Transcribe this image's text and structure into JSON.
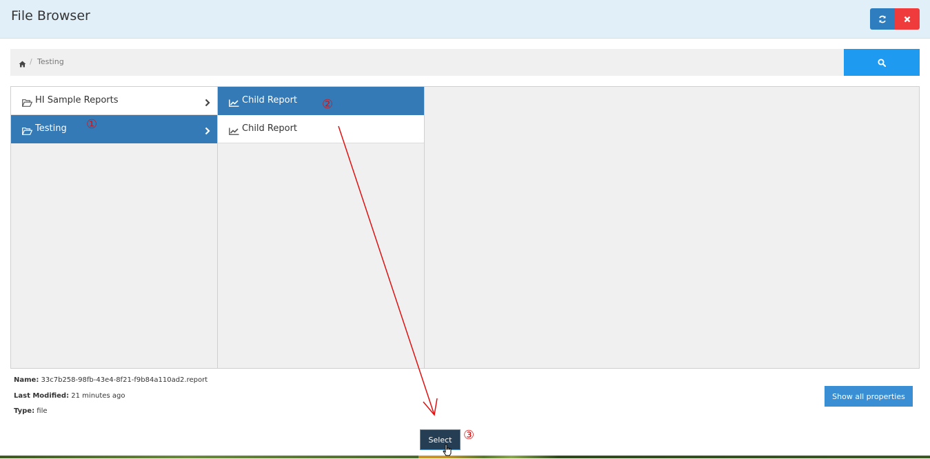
{
  "header": {
    "title": "File Browser",
    "refresh_icon": "refresh-icon",
    "close_icon": "close-icon"
  },
  "breadcrumb": {
    "home_icon": "home-icon",
    "separator": "/",
    "items": [
      "Testing"
    ]
  },
  "search": {
    "icon": "search-icon"
  },
  "columns": [
    {
      "items": [
        {
          "label": "HI Sample Reports",
          "icon": "folder-open-icon",
          "selected": false,
          "has_children": true
        },
        {
          "label": "Testing",
          "icon": "folder-open-icon",
          "selected": true,
          "has_children": true
        }
      ]
    },
    {
      "items": [
        {
          "label": "Child Report",
          "icon": "line-chart-icon",
          "selected": true
        },
        {
          "label": "Child Report",
          "icon": "line-chart-icon",
          "selected": false
        }
      ]
    }
  ],
  "properties": {
    "name_label": "Name:",
    "name_value": "33c7b258-98fb-43e4-8f21-f9b84a110ad2.report",
    "modified_label": "Last Modified:",
    "modified_value": "21 minutes ago",
    "type_label": "Type:",
    "type_value": "file"
  },
  "buttons": {
    "show_all": "Show all properties",
    "select": "Select"
  },
  "annotations": {
    "one": "①",
    "two": "②",
    "three": "③"
  },
  "colors": {
    "header_bg": "#e1eff8",
    "selected": "#337ab7",
    "search": "#1e9bf0",
    "close": "#ef3b3b",
    "annotation": "#dd1111"
  }
}
